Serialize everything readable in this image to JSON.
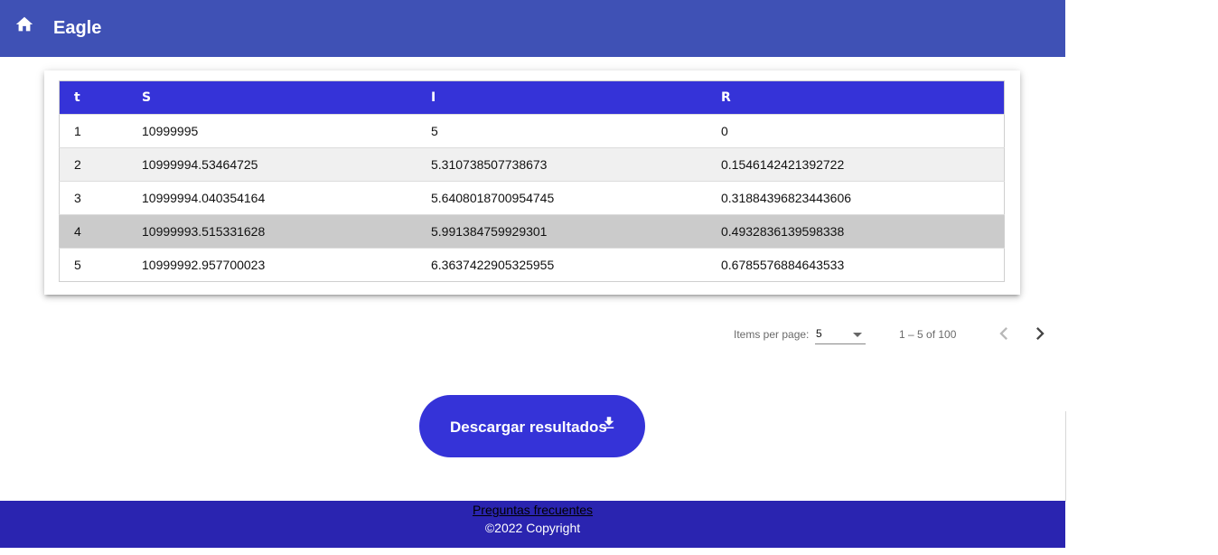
{
  "header": {
    "title": "Eagle",
    "home_icon": "home-icon"
  },
  "table": {
    "columns": [
      "t",
      "S",
      "I",
      "R"
    ],
    "rows": [
      [
        "1",
        "10999995",
        "5",
        "0"
      ],
      [
        "2",
        "10999994.53464725",
        "5.310738507738673",
        "0.1546142421392722"
      ],
      [
        "3",
        "10999994.040354164",
        "5.6408018700954745",
        "0.31884396823443606"
      ],
      [
        "4",
        "10999993.515331628",
        "5.991384759929301",
        "0.4932836139598338"
      ],
      [
        "5",
        "10999992.957700023",
        "6.3637422905325955",
        "0.6785576884643533"
      ]
    ]
  },
  "paginator": {
    "items_per_page_label": "Items per page:",
    "items_per_page_value": "5",
    "range_label": "1 – 5 of 100"
  },
  "actions": {
    "download_label": "Descargar resultados",
    "download_icon": "download-icon"
  },
  "footer": {
    "faq_link": "Preguntas frecuentes",
    "copyright": "©2022 Copyright"
  },
  "colors": {
    "toolbar": "#3f51b5",
    "table_header": "#3533d8",
    "button": "#3533d8",
    "footer": "#2a24b0"
  }
}
